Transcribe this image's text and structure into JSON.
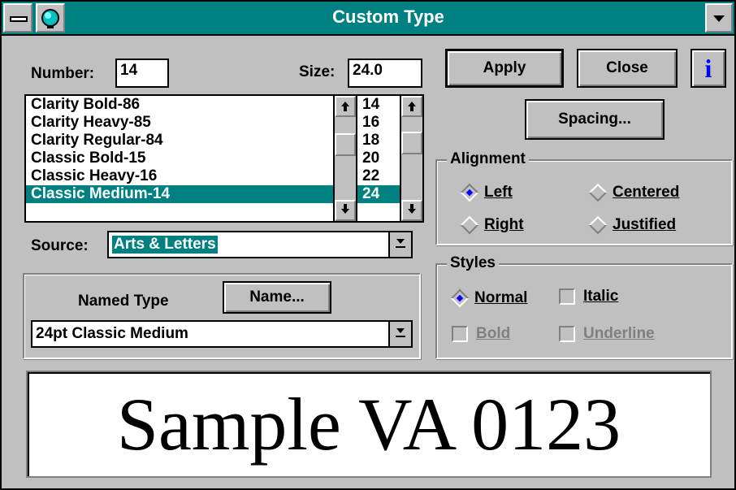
{
  "window": {
    "title": "Custom Type"
  },
  "number": {
    "label": "Number:",
    "value": "14"
  },
  "size": {
    "label": "Size:",
    "value": "24.0"
  },
  "fonts": [
    {
      "label": "Clarity Bold-86",
      "selected": false
    },
    {
      "label": "Clarity Heavy-85",
      "selected": false
    },
    {
      "label": "Clarity Regular-84",
      "selected": false
    },
    {
      "label": "Classic Bold-15",
      "selected": false
    },
    {
      "label": "Classic Heavy-16",
      "selected": false
    },
    {
      "label": "Classic Medium-14",
      "selected": true
    }
  ],
  "sizes": [
    {
      "label": "14",
      "selected": false
    },
    {
      "label": "16",
      "selected": false
    },
    {
      "label": "18",
      "selected": false
    },
    {
      "label": "20",
      "selected": false
    },
    {
      "label": "22",
      "selected": false
    },
    {
      "label": "24",
      "selected": true
    }
  ],
  "source": {
    "label": "Source:",
    "value": "Arts & Letters"
  },
  "named_type": {
    "label": "Named Type",
    "button": "Name...",
    "value": "24pt Classic Medium"
  },
  "buttons": {
    "apply": "Apply",
    "close": "Close",
    "info": "i",
    "spacing": "Spacing..."
  },
  "alignment": {
    "title": "Alignment",
    "left": "Left",
    "centered": "Centered",
    "right": "Right",
    "justified": "Justified",
    "selected": "Left"
  },
  "styles": {
    "title": "Styles",
    "normal": "Normal",
    "italic": "Italic",
    "bold": "Bold",
    "underline": "Underline",
    "selected": "Normal"
  },
  "sample": {
    "text": "Sample VA 0123"
  },
  "colors": {
    "titlebar": "#008080",
    "selection": "#008080",
    "face": "#c0c0c0",
    "radio_dot": "#0000ff",
    "info_icon": "#0000ff"
  }
}
